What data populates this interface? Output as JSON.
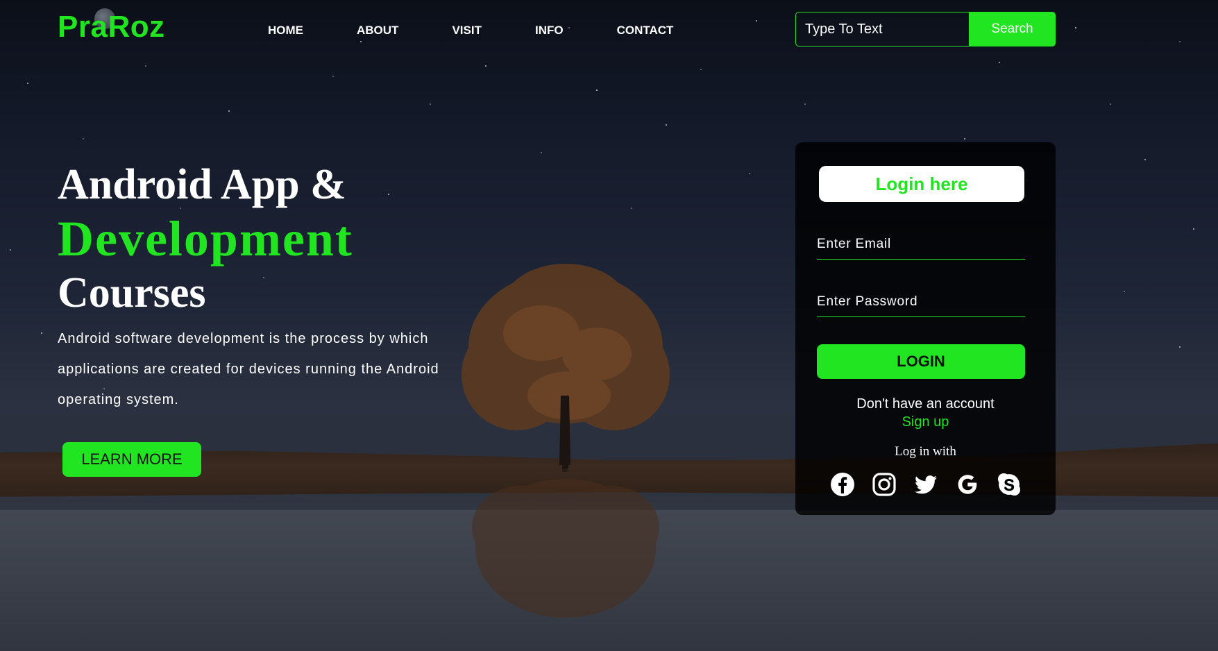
{
  "brand": {
    "name": "PraRoz"
  },
  "nav": {
    "items": [
      {
        "label": "HOME"
      },
      {
        "label": "ABOUT"
      },
      {
        "label": "VISIT"
      },
      {
        "label": "INFO"
      },
      {
        "label": "CONTACT"
      }
    ]
  },
  "search": {
    "placeholder": "Type To Text",
    "button_label": "Search"
  },
  "hero": {
    "title_line1": "Android App &",
    "title_line2": "Development",
    "title_line3": "Courses",
    "description": "Android software development is the process by which applications are created for devices running the Android operating system.",
    "cta_label": "LEARN MORE"
  },
  "login": {
    "title": "Login here",
    "email_placeholder": "Enter Email",
    "password_placeholder": "Enter Password",
    "button_label": "LOGIN",
    "no_account_text": "Don't have an account",
    "signup_label": "Sign up",
    "login_with_text": "Log in with",
    "social_icons": [
      "facebook-icon",
      "instagram-icon",
      "twitter-icon",
      "google-icon",
      "skype-icon"
    ]
  },
  "colors": {
    "accent": "#22e522",
    "text": "#ffffff",
    "card_bg": "#000000"
  }
}
